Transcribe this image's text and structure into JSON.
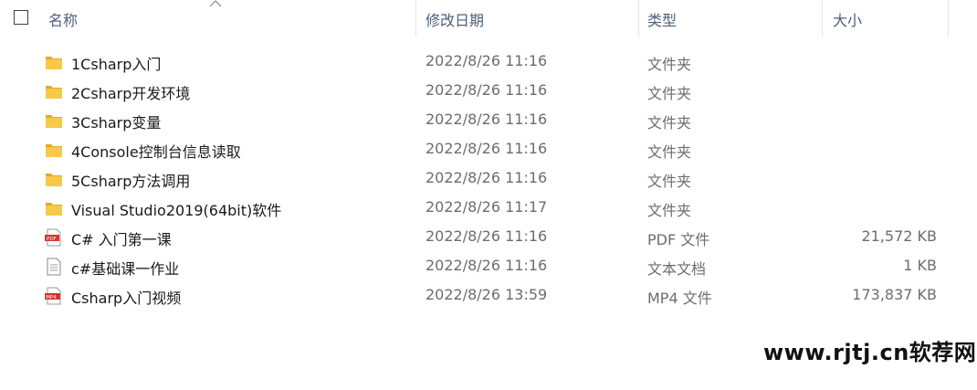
{
  "header": {
    "col_name": "名称",
    "col_date": "修改日期",
    "col_type": "类型",
    "col_size": "大小"
  },
  "icons": {
    "folder": "folder-icon",
    "pdf": "pdf-file-icon",
    "text": "text-file-icon",
    "video": "mp4-file-icon"
  },
  "colors": {
    "folder": "#f7c948",
    "folder_dark": "#e4a82b",
    "pdf_red": "#d6342c",
    "header_text": "#4c607a"
  },
  "files": [
    {
      "name": "1Csharp入门",
      "date": "2022/8/26 11:16",
      "type": "文件夹",
      "size": "",
      "icon": "folder"
    },
    {
      "name": "2Csharp开发环境",
      "date": "2022/8/26 11:16",
      "type": "文件夹",
      "size": "",
      "icon": "folder"
    },
    {
      "name": "3Csharp变量",
      "date": "2022/8/26 11:16",
      "type": "文件夹",
      "size": "",
      "icon": "folder"
    },
    {
      "name": "4Console控制台信息读取",
      "date": "2022/8/26 11:16",
      "type": "文件夹",
      "size": "",
      "icon": "folder"
    },
    {
      "name": "5Csharp方法调用",
      "date": "2022/8/26 11:16",
      "type": "文件夹",
      "size": "",
      "icon": "folder"
    },
    {
      "name": "Visual Studio2019(64bit)软件",
      "date": "2022/8/26 11:17",
      "type": "文件夹",
      "size": "",
      "icon": "folder"
    },
    {
      "name": "C# 入门第一课",
      "date": "2022/8/26 11:16",
      "type": "PDF 文件",
      "size": "21,572 KB",
      "icon": "pdf"
    },
    {
      "name": "c#基础课一作业",
      "date": "2022/8/26 11:16",
      "type": "文本文档",
      "size": "1 KB",
      "icon": "text"
    },
    {
      "name": "Csharp入门视频",
      "date": "2022/8/26 13:59",
      "type": "MP4 文件",
      "size": "173,837 KB",
      "icon": "video"
    }
  ],
  "watermark": "www.rjtj.cn软荐网"
}
